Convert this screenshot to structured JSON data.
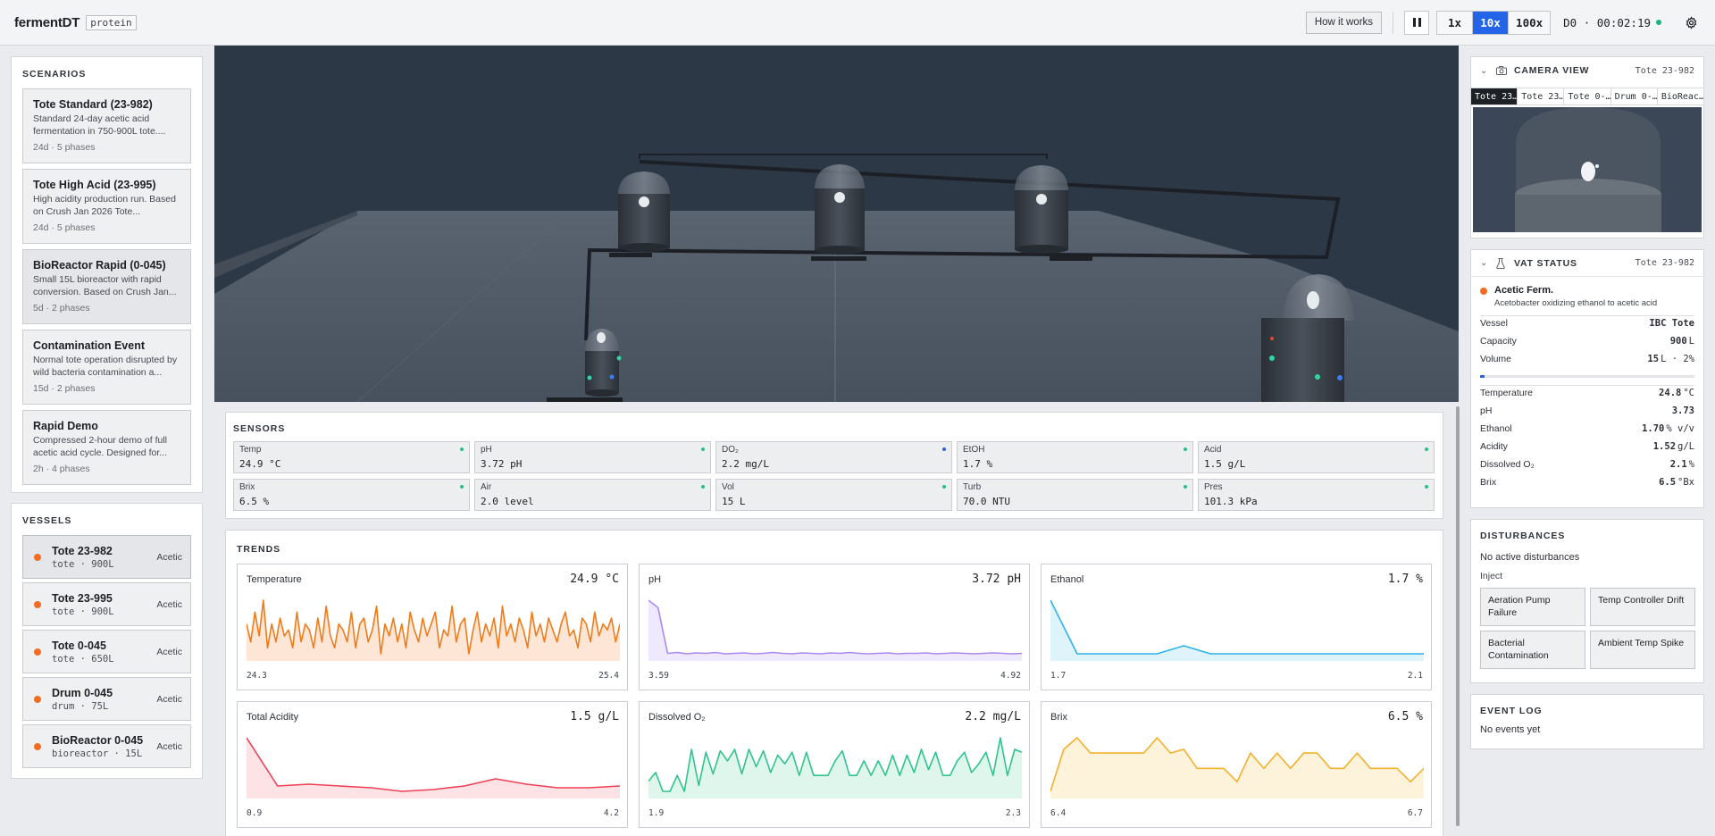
{
  "header": {
    "app_title": "fermentDT",
    "app_tag": "protein",
    "how_label": "How it works",
    "speeds": [
      {
        "label": "1x",
        "active": false
      },
      {
        "label": "10x",
        "active": true
      },
      {
        "label": "100x",
        "active": false
      }
    ],
    "clock": "D0 · 00:02:19",
    "icons": {
      "pause": "pause-icon",
      "settings": "gear-icon",
      "live": "status-dot"
    }
  },
  "scenarios": {
    "title": "SCENARIOS",
    "items": [
      {
        "title": "Tote Standard (23-982)",
        "desc": "Standard 24-day acetic acid fermentation in 750-900L tote....",
        "meta": "24d · 5 phases",
        "selected": false
      },
      {
        "title": "Tote High Acid (23-995)",
        "desc": "High acidity production run. Based on Crush Jan 2026 Tote...",
        "meta": "24d · 5 phases",
        "selected": false
      },
      {
        "title": "BioReactor Rapid (0-045)",
        "desc": "Small 15L bioreactor with rapid conversion. Based on Crush Jan...",
        "meta": "5d · 2 phases",
        "selected": true
      },
      {
        "title": "Contamination Event",
        "desc": "Normal tote operation disrupted by wild bacteria contamination a...",
        "meta": "15d · 2 phases",
        "selected": false
      },
      {
        "title": "Rapid Demo",
        "desc": "Compressed 2-hour demo of full acetic acid cycle. Designed for...",
        "meta": "2h · 4 phases",
        "selected": false
      }
    ]
  },
  "vessels": {
    "title": "VESSELS",
    "items": [
      {
        "name": "Tote 23-982",
        "sub": "tote · 900L",
        "tag": "Acetic",
        "selected": true
      },
      {
        "name": "Tote 23-995",
        "sub": "tote · 900L",
        "tag": "Acetic",
        "selected": false
      },
      {
        "name": "Tote 0-045",
        "sub": "tote · 650L",
        "tag": "Acetic",
        "selected": false
      },
      {
        "name": "Drum 0-045",
        "sub": "drum · 75L",
        "tag": "Acetic",
        "selected": false
      },
      {
        "name": "BioReactor 0-045",
        "sub": "bioreactor · 15L",
        "tag": "Acetic",
        "selected": false
      }
    ],
    "status_color": "#f26d21"
  },
  "sensors": {
    "title": "SENSORS",
    "items": [
      {
        "label": "Temp",
        "value": "24.9 °C",
        "dot": "green"
      },
      {
        "label": "pH",
        "value": "3.72 pH",
        "dot": "green"
      },
      {
        "label": "DO₂",
        "value": "2.2 mg/L",
        "dot": "blue"
      },
      {
        "label": "EtOH",
        "value": "1.7 %",
        "dot": "green"
      },
      {
        "label": "Acid",
        "value": "1.5 g/L",
        "dot": "green"
      },
      {
        "label": "Brix",
        "value": "6.5 %",
        "dot": "green"
      },
      {
        "label": "Air",
        "value": "2.0 level",
        "dot": "green"
      },
      {
        "label": "Vol",
        "value": "15 L",
        "dot": "green"
      },
      {
        "label": "Turb",
        "value": "70.0 NTU",
        "dot": "green"
      },
      {
        "label": "Pres",
        "value": "101.3 kPa",
        "dot": "green"
      }
    ]
  },
  "trends": {
    "title": "TRENDS",
    "charts": [
      {
        "name": "Temperature",
        "value": "24.9 °C",
        "min": "24.3",
        "max": "25.4",
        "color": "#f07b1a",
        "fill": "#fde6d6",
        "points": [
          24.9,
          24.6,
          25.1,
          24.7,
          25.3,
          24.5,
          24.9,
          24.6,
          25.0,
          24.7,
          24.8,
          24.5,
          25.1,
          24.6,
          24.9,
          24.8,
          24.5,
          25.0,
          24.6,
          25.2,
          24.7,
          24.5,
          24.9,
          24.8,
          24.6,
          25.1,
          24.5,
          24.9,
          25.0,
          24.6,
          24.8,
          25.2,
          24.4,
          24.9,
          24.7,
          25.0,
          24.6,
          24.9,
          24.5,
          25.1,
          24.8,
          24.6,
          25.0,
          24.7,
          24.9,
          25.1,
          24.5,
          24.8,
          24.7,
          25.2,
          24.6,
          24.9,
          25.0,
          24.4,
          24.8,
          25.1,
          24.6,
          24.9,
          24.7,
          25.0,
          24.5,
          25.2,
          24.7,
          24.9,
          24.6,
          25.0,
          24.8,
          24.5,
          25.1,
          24.7,
          24.9,
          24.6,
          25.0,
          24.8,
          24.6,
          24.9,
          25.1,
          24.7,
          24.8,
          24.5,
          25.0,
          24.9,
          24.6,
          25.1,
          24.7,
          24.9,
          24.8,
          25.0,
          24.6,
          24.9
        ]
      },
      {
        "name": "pH",
        "value": "3.72 pH",
        "min": "3.59",
        "max": "4.92",
        "color": "#a98af0",
        "fill": "#efe9fd",
        "points": [
          4.92,
          4.75,
          3.72,
          3.74,
          3.71,
          3.73,
          3.72,
          3.74,
          3.71,
          3.72,
          3.73,
          3.71,
          3.72,
          3.74,
          3.72,
          3.71,
          3.73,
          3.72,
          3.71,
          3.73,
          3.72,
          3.74,
          3.72,
          3.71,
          3.72,
          3.73,
          3.71,
          3.72,
          3.72,
          3.73,
          3.71,
          3.72,
          3.73,
          3.72,
          3.71,
          3.72,
          3.73,
          3.72,
          3.71,
          3.72
        ]
      },
      {
        "name": "Ethanol",
        "value": "1.7 %",
        "min": "1.7",
        "max": "2.1",
        "color": "#2ab3e8",
        "fill": "#dff3fb",
        "points": [
          2.1,
          1.7,
          1.7,
          1.7,
          1.7,
          1.76,
          1.7,
          1.7,
          1.7,
          1.7,
          1.7,
          1.7,
          1.7,
          1.7,
          1.7
        ]
      },
      {
        "name": "Total Acidity",
        "value": "1.5 g/L",
        "min": "0.9",
        "max": "4.2",
        "color": "#ef3f55",
        "fill": "#fde3e6",
        "points": [
          4.2,
          1.5,
          1.6,
          1.5,
          1.4,
          1.2,
          1.3,
          1.5,
          1.9,
          1.6,
          1.4,
          1.4,
          1.5
        ]
      },
      {
        "name": "Dissolved O₂",
        "value": "2.2 mg/L",
        "min": "1.9",
        "max": "2.3",
        "color": "#2fc48d",
        "fill": "#def6ec",
        "points": [
          2.0,
          2.06,
          1.93,
          1.93,
          2.04,
          1.93,
          2.22,
          1.97,
          2.2,
          2.05,
          2.21,
          2.14,
          2.22,
          2.05,
          2.22,
          2.1,
          2.21,
          2.06,
          2.18,
          2.12,
          2.2,
          2.04,
          2.2,
          2.04,
          2.04,
          2.04,
          2.14,
          2.21,
          2.04,
          2.04,
          2.14,
          2.04,
          2.14,
          2.04,
          2.18,
          2.04,
          2.18,
          2.06,
          2.22,
          2.08,
          2.2,
          2.04,
          2.04,
          2.14,
          2.2,
          2.06,
          2.12,
          2.2,
          2.04,
          2.3,
          2.04,
          2.22,
          2.2
        ]
      },
      {
        "name": "Brix",
        "value": "6.5 %",
        "min": "6.4",
        "max": "6.7",
        "color": "#f5b02a",
        "fill": "#fdf2da",
        "points": [
          6.4,
          6.62,
          6.68,
          6.6,
          6.6,
          6.6,
          6.6,
          6.6,
          6.68,
          6.6,
          6.62,
          6.52,
          6.52,
          6.52,
          6.45,
          6.6,
          6.52,
          6.6,
          6.52,
          6.6,
          6.6,
          6.52,
          6.52,
          6.6,
          6.52,
          6.52,
          6.52,
          6.45,
          6.52
        ]
      }
    ]
  },
  "camera": {
    "title": "CAMERA VIEW",
    "subtitle": "Tote 23-982",
    "tabs": [
      {
        "label": "Tote 23…",
        "active": true
      },
      {
        "label": "Tote 23…",
        "active": false
      },
      {
        "label": "Tote 0-…",
        "active": false
      },
      {
        "label": "Drum 0-…",
        "active": false
      },
      {
        "label": "BioReac…",
        "active": false
      }
    ]
  },
  "vat": {
    "title": "VAT STATUS",
    "subtitle": "Tote 23-982",
    "state_title": "Acetic Ferm.",
    "state_desc": "Acetobacter oxidizing ethanol to acetic acid",
    "vessel_rows": [
      {
        "label": "Vessel",
        "value": "IBC Tote",
        "unit": ""
      },
      {
        "label": "Capacity",
        "value": "900",
        "unit": "L"
      },
      {
        "label": "Volume",
        "value": "15",
        "unit": "L · 2%"
      }
    ],
    "volume_fraction": 0.02,
    "reading_rows": [
      {
        "label": "Temperature",
        "value": "24.8",
        "unit": "°C"
      },
      {
        "label": "pH",
        "value": "3.73",
        "unit": ""
      },
      {
        "label": "Ethanol",
        "value": "1.70",
        "unit": "% v/v"
      },
      {
        "label": "Acidity",
        "value": "1.52",
        "unit": "g/L"
      },
      {
        "label": "Dissolved O₂",
        "value": "2.1",
        "unit": "%"
      },
      {
        "label": "Brix",
        "value": "6.5",
        "unit": "°Bx"
      }
    ]
  },
  "disturbances": {
    "title": "DISTURBANCES",
    "none_text": "No active disturbances",
    "inject_label": "Inject",
    "buttons": [
      "Aeration Pump Failure",
      "Temp Controller Drift",
      "Bacterial Contamination",
      "Ambient Temp Spike"
    ]
  },
  "event_log": {
    "title": "EVENT LOG",
    "none_text": "No events yet"
  }
}
